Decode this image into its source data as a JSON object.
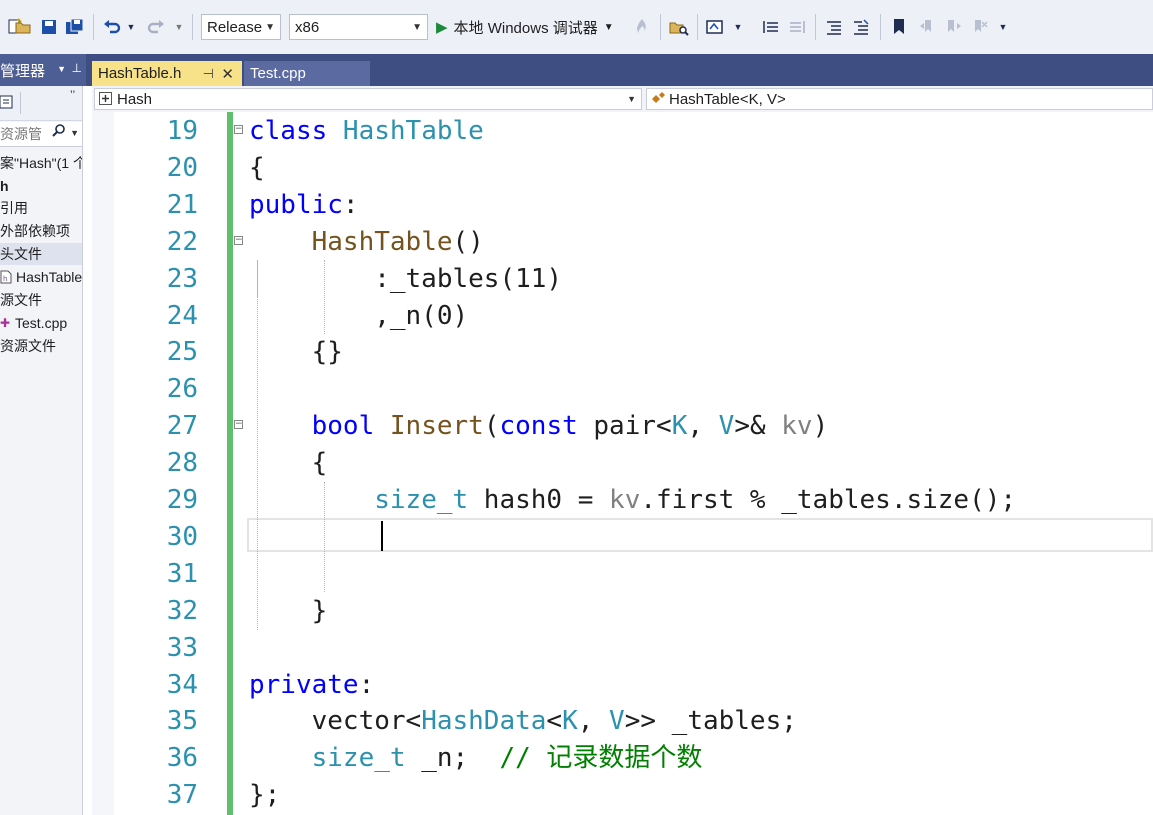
{
  "toolbar": {
    "config": "Release",
    "platform": "x86",
    "run_label": "本地 Windows 调试器"
  },
  "explorer": {
    "title": "管理器",
    "search_placeholder": "资源管",
    "items": [
      {
        "label": "案\"Hash\"(1 个"
      },
      {
        "label": "h"
      },
      {
        "label": "引用"
      },
      {
        "label": "外部依赖项"
      },
      {
        "label": "头文件"
      },
      {
        "label": "HashTable"
      },
      {
        "label": "源文件"
      },
      {
        "label": "Test.cpp"
      },
      {
        "label": "资源文件"
      }
    ]
  },
  "tabs": [
    {
      "label": "HashTable.h",
      "active": true
    },
    {
      "label": "Test.cpp",
      "active": false
    }
  ],
  "navbar": {
    "scope": "Hash",
    "member": "HashTable<K, V>"
  },
  "editor": {
    "lines": [
      {
        "num": "19",
        "tokens": [
          {
            "t": "class ",
            "c": "kw"
          },
          {
            "t": "HashTable",
            "c": "ty"
          }
        ]
      },
      {
        "num": "20",
        "tokens": [
          {
            "t": "{",
            "c": ""
          }
        ]
      },
      {
        "num": "21",
        "tokens": [
          {
            "t": "public",
            "c": "kw"
          },
          {
            "t": ":",
            "c": ""
          }
        ]
      },
      {
        "num": "22",
        "tokens": [
          {
            "t": "    ",
            "c": ""
          },
          {
            "t": "HashTable",
            "c": "fn"
          },
          {
            "t": "()",
            "c": ""
          }
        ]
      },
      {
        "num": "23",
        "tokens": [
          {
            "t": "        :_tables(11)",
            "c": ""
          }
        ]
      },
      {
        "num": "24",
        "tokens": [
          {
            "t": "        ,_n(0)",
            "c": ""
          }
        ]
      },
      {
        "num": "25",
        "tokens": [
          {
            "t": "    {}",
            "c": ""
          }
        ]
      },
      {
        "num": "26",
        "tokens": []
      },
      {
        "num": "27",
        "tokens": [
          {
            "t": "    ",
            "c": ""
          },
          {
            "t": "bool ",
            "c": "kw"
          },
          {
            "t": "Insert",
            "c": "fn"
          },
          {
            "t": "(",
            "c": ""
          },
          {
            "t": "const ",
            "c": "kw"
          },
          {
            "t": "pair<",
            "c": ""
          },
          {
            "t": "K",
            "c": "ty"
          },
          {
            "t": ", ",
            "c": ""
          },
          {
            "t": "V",
            "c": "ty"
          },
          {
            "t": ">& ",
            "c": ""
          },
          {
            "t": "kv",
            "c": "pm"
          },
          {
            "t": ")",
            "c": ""
          }
        ]
      },
      {
        "num": "28",
        "tokens": [
          {
            "t": "    {",
            "c": ""
          }
        ]
      },
      {
        "num": "29",
        "tokens": [
          {
            "t": "        ",
            "c": ""
          },
          {
            "t": "size_t",
            "c": "ty"
          },
          {
            "t": " hash0 = ",
            "c": ""
          },
          {
            "t": "kv",
            "c": "pm"
          },
          {
            "t": ".first % _tables.size();",
            "c": ""
          }
        ]
      },
      {
        "num": "30",
        "tokens": []
      },
      {
        "num": "31",
        "tokens": []
      },
      {
        "num": "32",
        "tokens": [
          {
            "t": "    }",
            "c": ""
          }
        ]
      },
      {
        "num": "33",
        "tokens": []
      },
      {
        "num": "34",
        "tokens": [
          {
            "t": "private",
            "c": "kw"
          },
          {
            "t": ":",
            "c": ""
          }
        ]
      },
      {
        "num": "35",
        "tokens": [
          {
            "t": "    vector<",
            "c": ""
          },
          {
            "t": "HashData",
            "c": "ty"
          },
          {
            "t": "<",
            "c": ""
          },
          {
            "t": "K",
            "c": "ty"
          },
          {
            "t": ", ",
            "c": ""
          },
          {
            "t": "V",
            "c": "ty"
          },
          {
            "t": ">> _tables;",
            "c": ""
          }
        ]
      },
      {
        "num": "36",
        "tokens": [
          {
            "t": "    ",
            "c": ""
          },
          {
            "t": "size_t",
            "c": "ty"
          },
          {
            "t": " _n;  ",
            "c": ""
          },
          {
            "t": "// 记录数据个数",
            "c": "cm"
          }
        ]
      },
      {
        "num": "37",
        "tokens": [
          {
            "t": "};",
            "c": ""
          }
        ]
      }
    ]
  }
}
